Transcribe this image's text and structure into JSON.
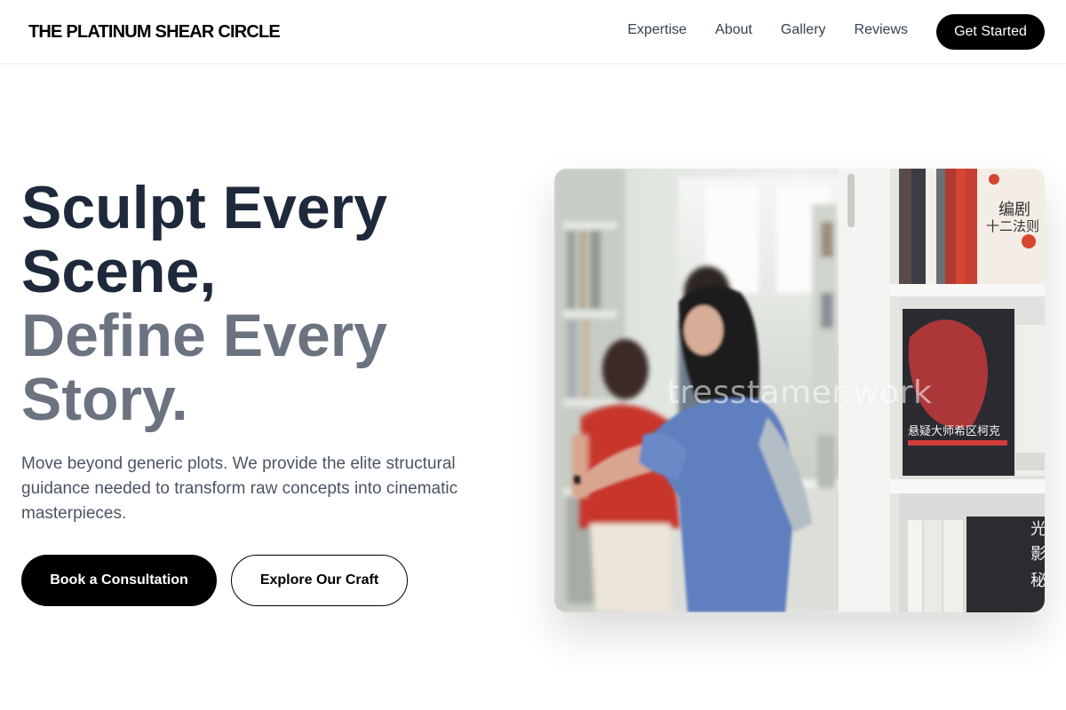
{
  "header": {
    "brand": "THE PLATINUM SHEAR CIRCLE",
    "nav": [
      "Expertise",
      "About",
      "Gallery",
      "Reviews"
    ],
    "cta": "Get Started"
  },
  "hero": {
    "title_line1": "Sculpt Every",
    "title_line2": "Scene,",
    "title_line3": "Define Every",
    "title_line4": "Story.",
    "subtitle": "Move beyond generic plots. We provide the elite structural guidance needed to transform raw concepts into cinematic masterpieces.",
    "primary_button": "Book a Consultation",
    "secondary_button": "Explore Our Craft",
    "image_watermark": "tresstamer.work",
    "image_book_titles": [
      "编剧十二法则",
      "悬疑大师希区柯克",
      "光影秘境"
    ]
  },
  "colors": {
    "accent": "#000000",
    "title_dark": "#1e293b",
    "title_muted": "#6b7280",
    "body_text": "#4b5563"
  }
}
